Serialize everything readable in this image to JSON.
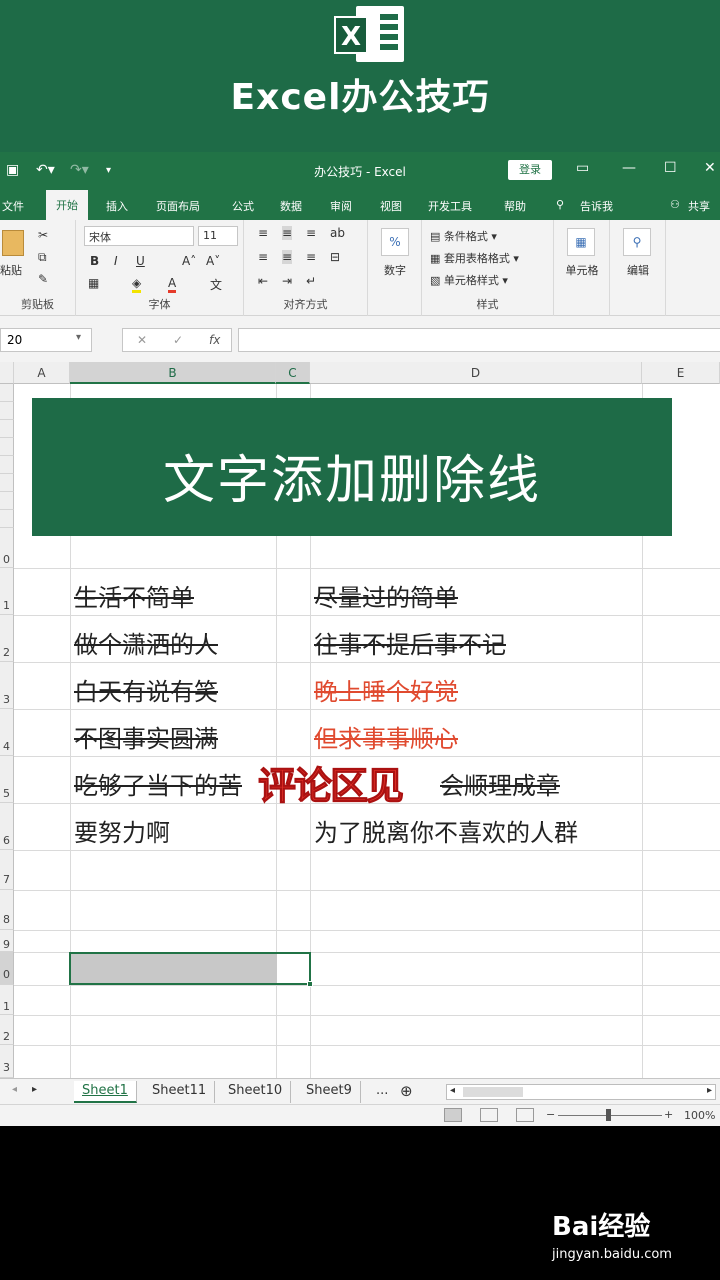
{
  "banner": {
    "logo_letter": "X",
    "title": "Excel办公技巧"
  },
  "window": {
    "title": "办公技巧 - Excel",
    "login": "登录"
  },
  "tabs": [
    "文件",
    "开始",
    "插入",
    "页面布局",
    "公式",
    "数据",
    "审阅",
    "视图",
    "开发工具",
    "帮助",
    "告诉我",
    "共享"
  ],
  "ribbon": {
    "clipboard": {
      "paste": "粘贴",
      "label": "剪贴板"
    },
    "font": {
      "name": "宋体",
      "size": "11",
      "label": "字体"
    },
    "alignment": {
      "label": "对齐方式"
    },
    "number": {
      "label": "数字",
      "icon_text": "%"
    },
    "styles": {
      "items": [
        "条件格式",
        "套用表格格式",
        "单元格样式"
      ],
      "label": "样式"
    },
    "cells": {
      "label": "单元格"
    },
    "editing": {
      "label": "编辑"
    }
  },
  "formula_bar": {
    "name_box": "20",
    "fx": "fx"
  },
  "columns": [
    "A",
    "B",
    "C",
    "D",
    "E"
  ],
  "rows": [
    "",
    "",
    "",
    "",
    "",
    "0",
    "1",
    "2",
    "3",
    "4",
    "5",
    "6",
    "7",
    "8",
    "9",
    "0",
    "1",
    "2",
    "3"
  ],
  "sheet": {
    "header_title": "文字添加删除线",
    "cells": [
      {
        "left": "生活不简单",
        "right": "尽量过的简单",
        "right_red": false
      },
      {
        "left": "做个潇洒的人",
        "right": "往事不提后事不记",
        "right_red": false
      },
      {
        "left": "白天有说有笑",
        "right": "晚上睡个好觉",
        "right_red": true
      },
      {
        "left": "不图事实圆满",
        "right": "但求事事顺心",
        "right_red": true
      },
      {
        "left": "吃够了当下的苦",
        "right": "会顺理成章",
        "right_red": false
      },
      {
        "left": "要努力啊",
        "right": "为了脱离你不喜欢的人群",
        "right_red": false
      }
    ],
    "overlay_text": "评论区见"
  },
  "sheet_tabs": [
    "Sheet1",
    "Sheet11",
    "Sheet10",
    "Sheet9",
    "..."
  ],
  "status": {
    "zoom": "100%"
  },
  "watermark": {
    "brand": "Bai经验",
    "url": "jingyan.baidu.com"
  },
  "colors": {
    "excel_green": "#217346",
    "banner_green": "#1e6b47",
    "red_text": "#e04a2f",
    "overlay_red": "#e8332a"
  }
}
